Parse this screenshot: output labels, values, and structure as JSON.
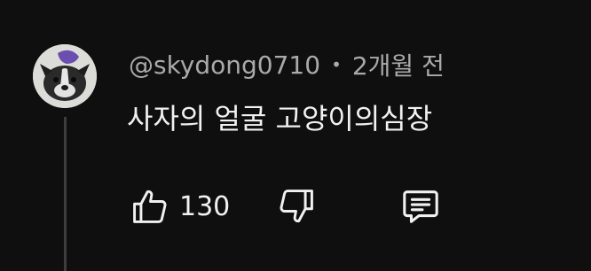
{
  "comment": {
    "author": "@skydong0710",
    "separator": "•",
    "time": "2개월 전",
    "text": "사자의 얼굴 고양이의심장",
    "like_count": "130"
  },
  "icons": {
    "like": "thumbs-up-icon",
    "dislike": "thumbs-down-icon",
    "reply": "reply-comment-icon"
  },
  "colors": {
    "background": "#0f0f0f",
    "text_primary": "#f1f1f1",
    "text_secondary": "#aaaaaa",
    "thread_line": "#3d3d3d"
  }
}
